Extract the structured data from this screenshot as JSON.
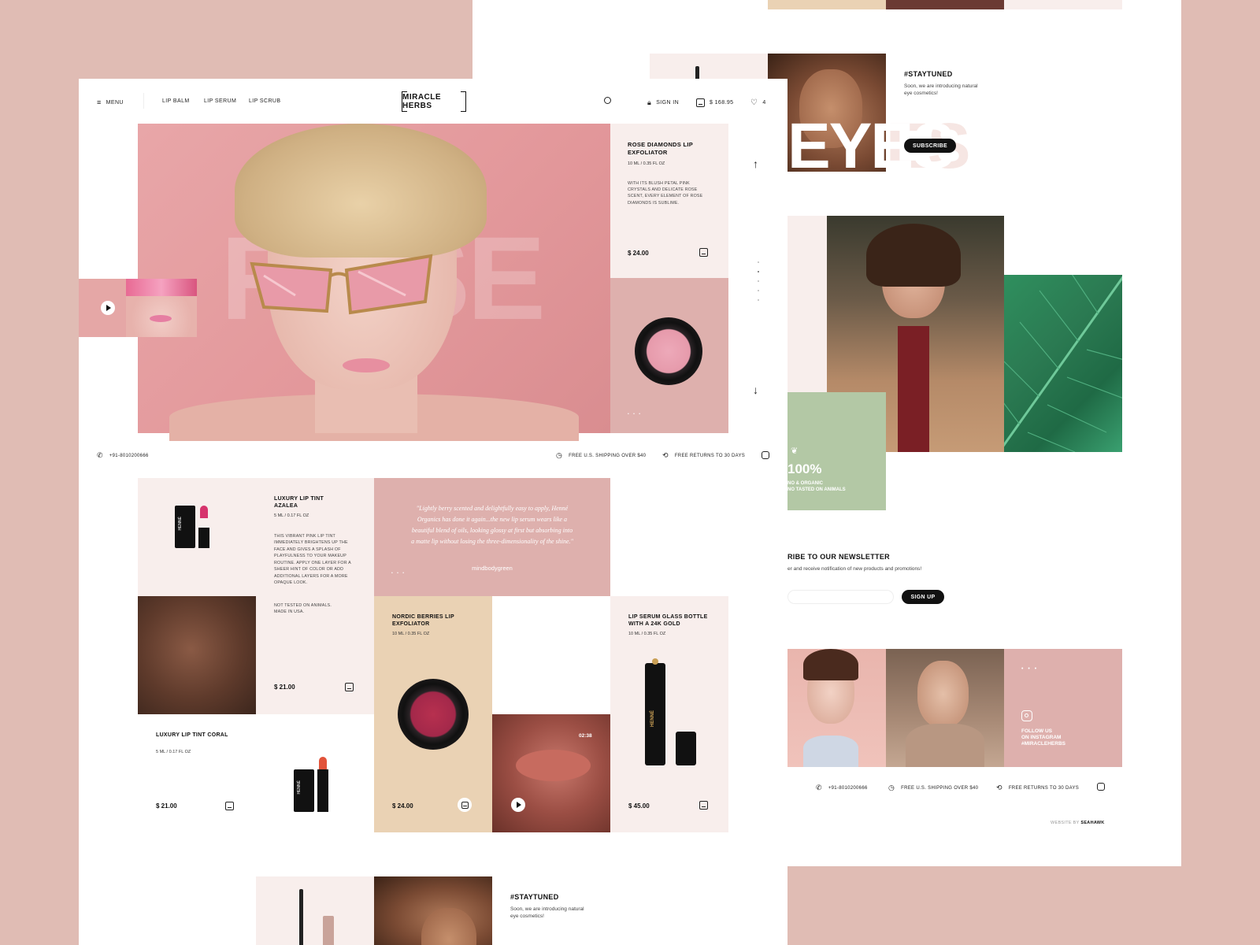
{
  "header": {
    "menu_label": "MENU",
    "nav": [
      "LIP BALM",
      "LIP SERUM",
      "LIP SCRUB"
    ],
    "logo": "MIRACLE HERBS",
    "sign_in": "SIGN IN",
    "cart_total": "$ 168.95",
    "wishlist_count": "4"
  },
  "hero": {
    "background_word": "ROSE",
    "featured": {
      "name": "ROSE DIAMONDS LIP EXFOLIATOR",
      "size": "10 ML / 0.35 FL OZ",
      "description": "WITH ITS BLUSH PETAL PINK CRYSTALS AND DELICATE ROSE SCENT, EVERY ELEMENT OF ROSE DIAMONDS IS SUBLIME.",
      "price": "$ 24.00"
    }
  },
  "infobar": {
    "phone": "+91-8010200666",
    "shipping": "FREE U.S. SHIPPING OVER $40",
    "returns": "FREE RETURNS TO 30 DAYS"
  },
  "products": {
    "azalea": {
      "name": "LUXURY LIP TINT AZALEA",
      "size": "5 ML / 0.17 FL OZ",
      "description": "THIS VIBRANT PINK LIP TINT IMMEDIATELY BRIGHTENS UP THE FACE AND GIVES A SPLASH OF PLAYFULNESS TO YOUR MAKEUP ROUTINE. APPLY ONE LAYER FOR A SHEER HINT OF COLOR OR ADD ADDITIONAL LAYERS FOR A MORE OPAQUE LOOK.",
      "note": "NOT TESTED ON ANIMALS. MADE IN USA.",
      "price": "$ 21.00",
      "brand": "HENNÉ"
    },
    "quote": {
      "text": "\"Lightly berry scented and delightfully easy to apply, Henné Organics has done it again...the new lip serum wears like a beautiful blend of oils, looking glossy at first but absorbing into a matte lip without losing the three-dimensionality of the shine.\"",
      "source": "mindbodygreen"
    },
    "nordic": {
      "name": "NORDIC BERRIES LIP EXFOLIATOR",
      "size": "10 ML / 0.35 FL OZ",
      "price": "$ 24.00"
    },
    "serum": {
      "name": "LIP SERUM GLASS BOTTLE WITH A 24K GOLD",
      "size": "10 ML / 0.35 FL OZ",
      "price": "$ 45.00",
      "brand": "HENNÉ"
    },
    "coral": {
      "name": "LUXURY LIP TINT CORAL",
      "size": "5 ML / 0.17 FL OZ",
      "price": "$ 21.00",
      "brand": "HENNÉ"
    },
    "video_time": "02:38"
  },
  "stay_tuned": {
    "title": "#STAYTUNED",
    "text": "Soon, we are introducing natural eye cosmetics!",
    "word": "EYES",
    "button": "SUBSCRIBE"
  },
  "organic": {
    "percent": "100%",
    "line1": "NO & ORGANIC",
    "line2": "NO TASTED ON ANIMALS"
  },
  "newsletter": {
    "title": "RIBE TO OUR NEWSLETTER",
    "text": "er and receive notification of new products and promotions!",
    "email_placeholder": "",
    "button": "SIGN UP"
  },
  "instagram": {
    "line1": "FOLLOW US",
    "line2": "ON INSTAGRAM",
    "line3": "#MIRACLEHERBS"
  },
  "footer": {
    "credit_prefix": "WEBSITE BY",
    "credit_name": "SEAHAWK"
  },
  "colors": {
    "background": "#e0bcb4",
    "blush": "#deb0ad",
    "cream": "#f8eeec",
    "sand": "#ead2b4",
    "sage": "#b3c8a5"
  }
}
